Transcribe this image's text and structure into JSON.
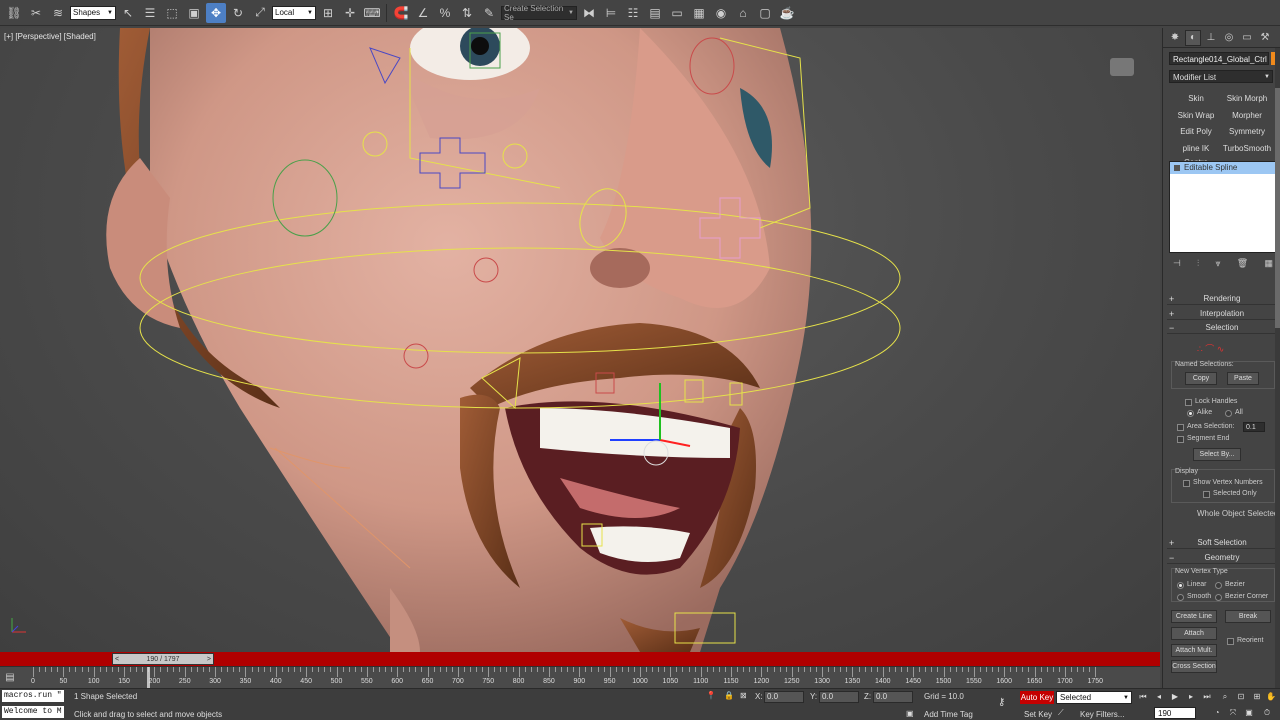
{
  "toolbar": {
    "selection_filter": "Shapes",
    "ref_coord": "Local",
    "named_selection": "Create Selection Se"
  },
  "viewport": {
    "label": "[+] [Perspective] [Shaded]"
  },
  "timeline": {
    "frame_range": "190 / 1797",
    "prev": "<",
    "next": ">",
    "ticks": [
      "0",
      "50",
      "100",
      "150",
      "200",
      "250",
      "300",
      "350",
      "400",
      "450",
      "500",
      "550",
      "600",
      "650",
      "700",
      "750",
      "800",
      "850",
      "900",
      "950",
      "1000",
      "1050",
      "1100",
      "1150",
      "1200",
      "1250",
      "1300",
      "1350",
      "1400",
      "1450",
      "1500",
      "1550",
      "1600",
      "1650",
      "1700",
      "1750"
    ],
    "current_frame": 190
  },
  "statusbar": {
    "script_line1": "macros.run \"",
    "script_line2": "Welcome to M",
    "selection_status": "1 Shape Selected",
    "prompt": "Click and drag to select and move objects",
    "x_label": "X:",
    "x_value": "0.0",
    "y_label": "Y:",
    "y_value": "0.0",
    "z_label": "Z:",
    "z_value": "0.0",
    "grid": "Grid = 10.0",
    "add_time_tag": "Add Time Tag",
    "auto_key": "Auto Key",
    "selected_dropdown": "Selected",
    "set_key": "Set Key",
    "key_filters": "Key Filters...",
    "frame": "190"
  },
  "panel": {
    "object_name": "Rectangle014_Global_Ctrl",
    "object_color": "#f08a1c",
    "modifier_list": "Modifier List",
    "modifiers": [
      "Skin",
      "Skin Morph",
      "Skin Wrap",
      "Morpher",
      "Edit Poly",
      "Symmetry",
      "pline IK Contro",
      "TurboSmooth"
    ],
    "stack": [
      "Editable Spline"
    ],
    "rollouts": {
      "rendering": "Rendering",
      "interpolation": "Interpolation",
      "selection": "Selection",
      "soft_selection": "Soft Selection",
      "geometry": "Geometry"
    },
    "selection": {
      "named_selections": "Named Selections:",
      "copy": "Copy",
      "paste": "Paste",
      "lock_handles": "Lock Handles",
      "alike": "Alike",
      "all": "All",
      "area_selection": "Area Selection:",
      "area_value": "0.1",
      "segment_end": "Segment End",
      "select_by": "Select By...",
      "display": "Display",
      "show_vertex_numbers": "Show Vertex Numbers",
      "selected_only": "Selected Only",
      "whole_object": "Whole Object Selected"
    },
    "geometry": {
      "new_vertex_type": "New Vertex Type",
      "linear": "Linear",
      "bezier": "Bezier",
      "smooth": "Smooth",
      "bezier_corner": "Bezier Corner",
      "create_line": "Create Line",
      "break": "Break",
      "attach": "Attach",
      "reorient": "Reorient",
      "attach_mult": "Attach Mult.",
      "cross_section": "Cross Section"
    }
  }
}
